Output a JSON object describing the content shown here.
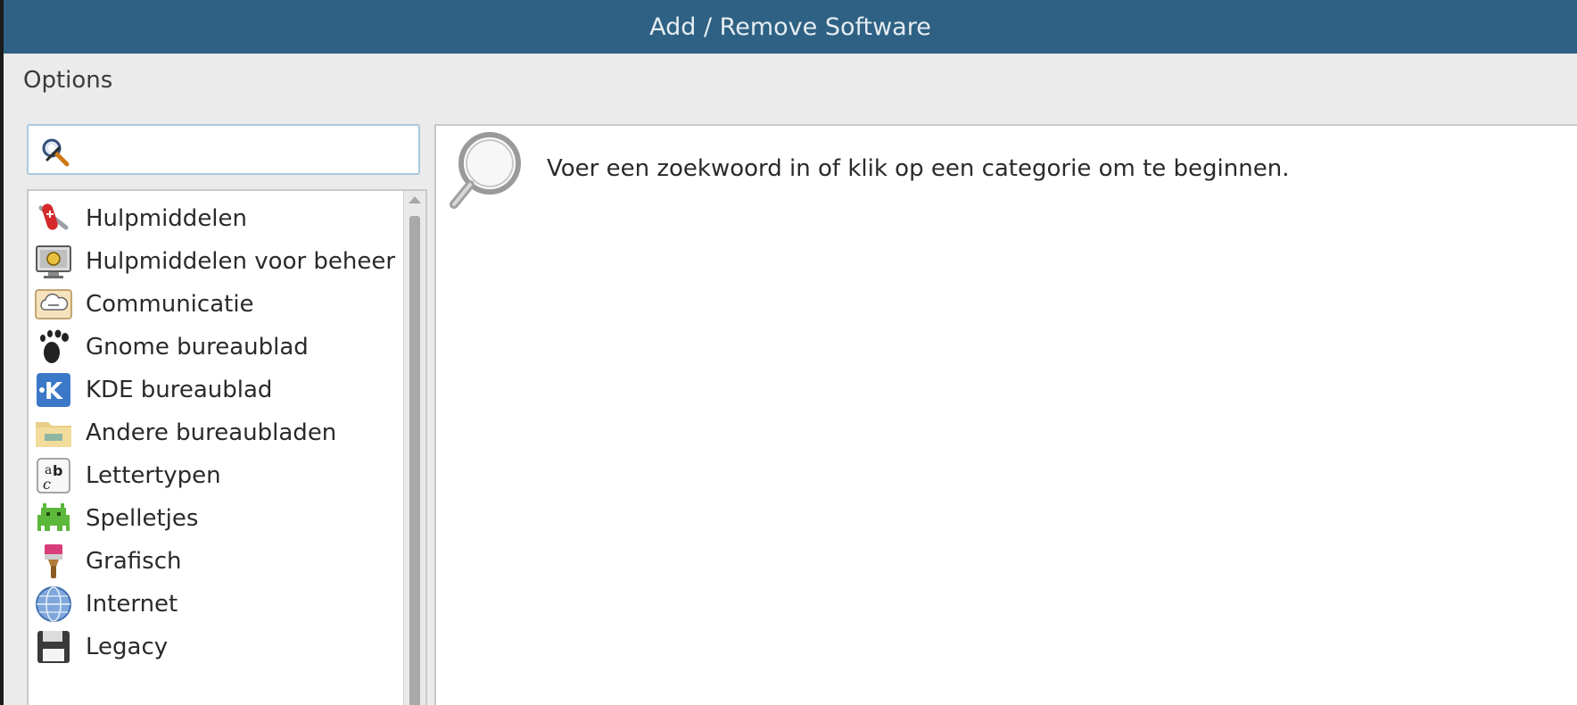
{
  "window": {
    "title": "Add / Remove Software"
  },
  "menubar": {
    "items": [
      {
        "label": "Options"
      }
    ]
  },
  "search": {
    "value": "",
    "icon": "search-icon"
  },
  "categories": [
    {
      "label": "Hulpmiddelen",
      "icon": "swiss-knife-icon"
    },
    {
      "label": "Hulpmiddelen voor beheer",
      "icon": "admin-monitor-icon"
    },
    {
      "label": "Communicatie",
      "icon": "communication-icon"
    },
    {
      "label": "Gnome bureaublad",
      "icon": "gnome-icon"
    },
    {
      "label": "KDE bureaublad",
      "icon": "kde-icon"
    },
    {
      "label": "Andere bureaubladen",
      "icon": "folder-icon"
    },
    {
      "label": "Lettertypen",
      "icon": "fonts-icon"
    },
    {
      "label": "Spelletjes",
      "icon": "games-icon"
    },
    {
      "label": "Grafisch",
      "icon": "paintbrush-icon"
    },
    {
      "label": "Internet",
      "icon": "globe-icon"
    },
    {
      "label": "Legacy",
      "icon": "floppy-icon"
    }
  ],
  "content": {
    "hint": "Voer een zoekwoord in of klik op een categorie om te beginnen.",
    "icon": "magnifier-icon"
  },
  "colors": {
    "titlebar": "#2e6183",
    "background": "#ebebeb",
    "panel": "#ffffff"
  }
}
